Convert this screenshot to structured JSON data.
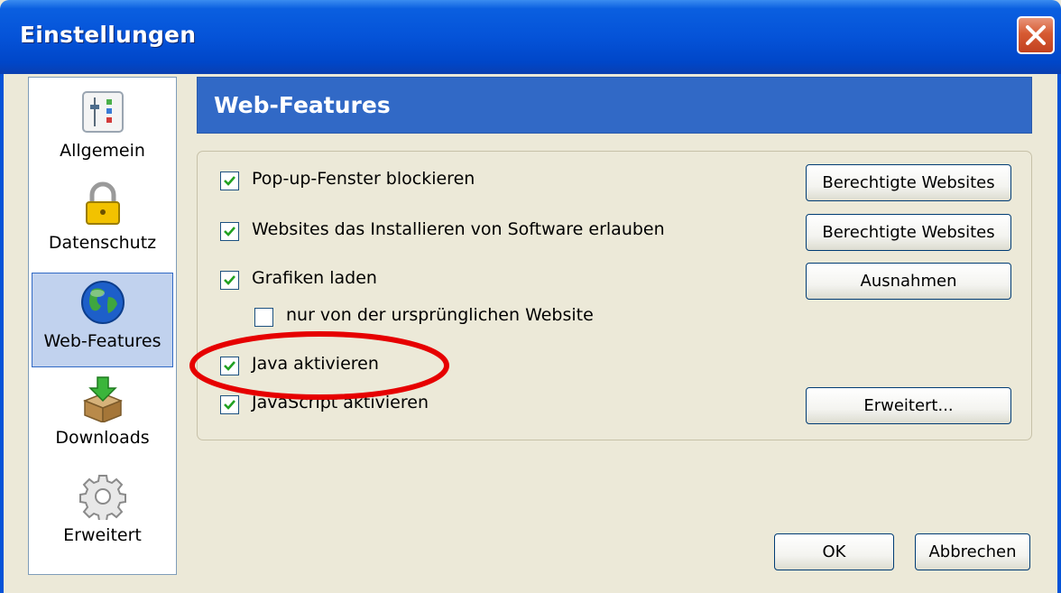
{
  "window": {
    "title": "Einstellungen"
  },
  "sidebar": {
    "items": [
      {
        "label": "Allgemein",
        "icon": "settings-sliders-icon"
      },
      {
        "label": "Datenschutz",
        "icon": "padlock-icon"
      },
      {
        "label": "Web-Features",
        "icon": "globe-icon",
        "selected": true
      },
      {
        "label": "Downloads",
        "icon": "download-box-icon"
      },
      {
        "label": "Erweitert",
        "icon": "gear-icon"
      }
    ]
  },
  "panel": {
    "header": "Web-Features",
    "options": [
      {
        "label": "Pop-up-Fenster blockieren",
        "checked": true
      },
      {
        "label": "Websites das Installieren von Software erlauben",
        "checked": true
      },
      {
        "label": "Grafiken laden",
        "checked": true
      },
      {
        "label": "nur von der ursprünglichen Website",
        "checked": false
      },
      {
        "label": "Java aktivieren",
        "checked": true
      },
      {
        "label": "JavaScript aktivieren",
        "checked": true
      }
    ],
    "buttons": {
      "popup_allowed": "Berechtigte Websites",
      "install_allowed": "Berechtigte Websites",
      "images_exceptions": "Ausnahmen",
      "js_advanced": "Erweitert..."
    }
  },
  "footer": {
    "ok": "OK",
    "cancel": "Abbrechen"
  },
  "colors": {
    "titlebar": "#0553d8",
    "header": "#3169c6",
    "annotation": "#e60000",
    "checkmark": "#21a121"
  }
}
